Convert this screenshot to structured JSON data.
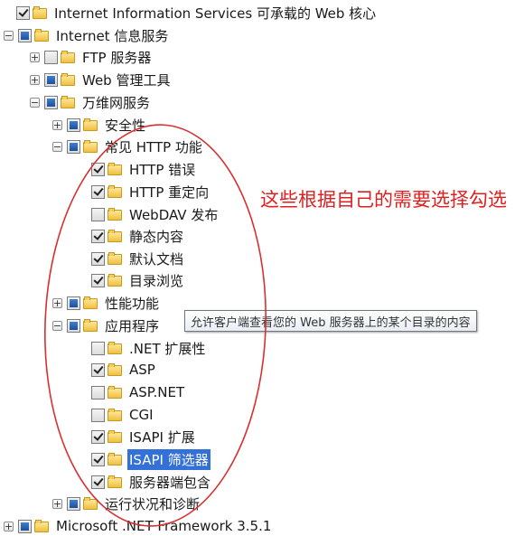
{
  "tree": [
    {
      "label": "Internet Information Services 可承载的 Web 核心",
      "check": "checked",
      "expander": "none"
    },
    {
      "label": "Internet 信息服务",
      "check": "partial",
      "expander": "minus"
    },
    {
      "label": "FTP 服务器",
      "check": "unchecked",
      "expander": "plus"
    },
    {
      "label": "Web 管理工具",
      "check": "partial",
      "expander": "plus"
    },
    {
      "label": "万维网服务",
      "check": "partial",
      "expander": "minus"
    },
    {
      "label": "安全性",
      "check": "partial",
      "expander": "plus"
    },
    {
      "label": "常见 HTTP 功能",
      "check": "partial",
      "expander": "minus"
    },
    {
      "label": "HTTP 错误",
      "check": "checked",
      "expander": "none"
    },
    {
      "label": "HTTP 重定向",
      "check": "checked",
      "expander": "none"
    },
    {
      "label": "WebDAV 发布",
      "check": "unchecked",
      "expander": "none"
    },
    {
      "label": "静态内容",
      "check": "checked",
      "expander": "none"
    },
    {
      "label": "默认文档",
      "check": "checked",
      "expander": "none"
    },
    {
      "label": "目录浏览",
      "check": "checked",
      "expander": "none"
    },
    {
      "label": "性能功能",
      "check": "partial",
      "expander": "plus"
    },
    {
      "label": "应用程序",
      "check": "partial",
      "expander": "minus"
    },
    {
      "label": ".NET 扩展性",
      "check": "unchecked",
      "expander": "none"
    },
    {
      "label": "ASP",
      "check": "checked",
      "expander": "none"
    },
    {
      "label": "ASP.NET",
      "check": "unchecked",
      "expander": "none"
    },
    {
      "label": "CGI",
      "check": "unchecked",
      "expander": "none"
    },
    {
      "label": "ISAPI 扩展",
      "check": "checked",
      "expander": "none"
    },
    {
      "label": "ISAPI 筛选器",
      "check": "checked",
      "expander": "none",
      "selected": true
    },
    {
      "label": "服务器端包含",
      "check": "checked",
      "expander": "none"
    },
    {
      "label": "运行状况和诊断",
      "check": "partial",
      "expander": "plus"
    },
    {
      "label": "Microsoft .NET Framework 3.5.1",
      "check": "partial",
      "expander": "plus"
    }
  ],
  "tooltip": "允许客户端查看您的 Web 服务器上的某个目录的内容",
  "annotation": "这些根据自己的需要选择勾选",
  "colors": {
    "annotation": "#e02020",
    "selection": "#3370d8"
  }
}
